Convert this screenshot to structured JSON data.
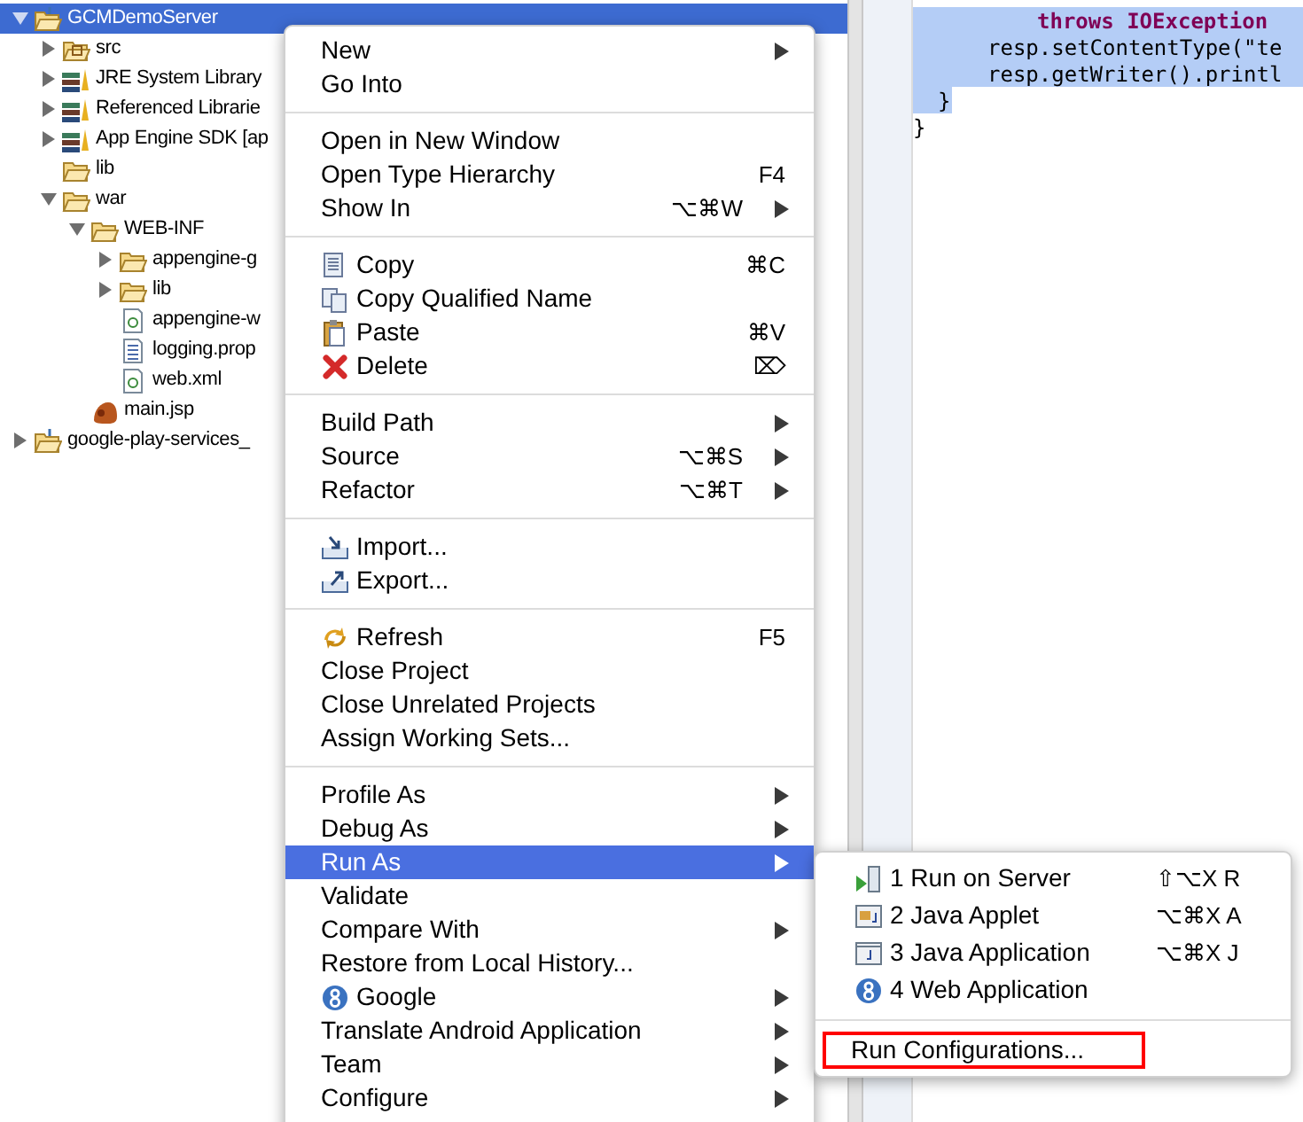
{
  "tree": [
    {
      "label": "GCMDemoServer",
      "kind": "project",
      "expanded": true,
      "selected": true,
      "children": [
        {
          "label": "src",
          "kind": "package-folder",
          "expanded": false,
          "selected": false
        },
        {
          "label": "JRE System Library",
          "kind": "library",
          "expanded": false,
          "selected": false
        },
        {
          "label": "Referenced Librarie",
          "kind": "library",
          "expanded": false,
          "selected": false
        },
        {
          "label": "App Engine SDK [ap",
          "kind": "library",
          "expanded": false,
          "selected": false
        },
        {
          "label": "lib",
          "kind": "folder",
          "selected": false
        },
        {
          "label": "war",
          "kind": "folder",
          "expanded": true,
          "selected": false,
          "children": [
            {
              "label": "WEB-INF",
              "kind": "folder",
              "expanded": true,
              "selected": false,
              "children": [
                {
                  "label": "appengine-g",
                  "kind": "folder",
                  "expanded": false,
                  "selected": false
                },
                {
                  "label": "lib",
                  "kind": "folder",
                  "expanded": false,
                  "selected": false
                },
                {
                  "label": "appengine-w",
                  "kind": "xml",
                  "selected": false
                },
                {
                  "label": "logging.prop",
                  "kind": "text",
                  "selected": false
                },
                {
                  "label": "web.xml",
                  "kind": "xml",
                  "selected": false
                }
              ]
            },
            {
              "label": "main.jsp",
              "kind": "jsp",
              "selected": false
            }
          ]
        }
      ]
    },
    {
      "label": "google-play-services_",
      "kind": "project",
      "expanded": false,
      "selected": false
    }
  ],
  "editor": {
    "lines": [
      {
        "text": "throws IOException",
        "kind": "throws",
        "selected": true
      },
      {
        "text": "resp.setContentType(\"te",
        "kind": "statement",
        "selected": true
      },
      {
        "text": "resp.getWriter().printl",
        "kind": "statement",
        "selected": true
      },
      {
        "text": "}",
        "kind": "method-end",
        "selected": true
      },
      {
        "text": "}",
        "kind": "class-end",
        "selected": false
      }
    ]
  },
  "context_menu": {
    "sections": [
      [
        {
          "label": "New",
          "submenu": true,
          "selected": false
        },
        {
          "label": "Go Into",
          "selected": false
        }
      ],
      [
        {
          "label": "Open in New Window",
          "selected": false
        },
        {
          "label": "Open Type Hierarchy",
          "shortcut": "F4",
          "selected": false
        },
        {
          "label": "Show In",
          "shortcut": "⌥⌘W",
          "submenu": true,
          "selected": false
        }
      ],
      [
        {
          "label": "Copy",
          "kind": "copy",
          "shortcut": "⌘C",
          "selected": false
        },
        {
          "label": "Copy Qualified Name",
          "kind": "copy-qualified",
          "selected": false
        },
        {
          "label": "Paste",
          "kind": "paste",
          "shortcut": "⌘V",
          "selected": false
        },
        {
          "label": "Delete",
          "kind": "delete",
          "shortcut": "⌦",
          "selected": false
        }
      ],
      [
        {
          "label": "Build Path",
          "submenu": true,
          "selected": false
        },
        {
          "label": "Source",
          "shortcut": "⌥⌘S",
          "submenu": true,
          "selected": false
        },
        {
          "label": "Refactor",
          "shortcut": "⌥⌘T",
          "submenu": true,
          "selected": false
        }
      ],
      [
        {
          "label": "Import...",
          "kind": "import",
          "selected": false
        },
        {
          "label": "Export...",
          "kind": "export",
          "selected": false
        }
      ],
      [
        {
          "label": "Refresh",
          "kind": "refresh",
          "shortcut": "F5",
          "selected": false
        },
        {
          "label": "Close Project",
          "selected": false
        },
        {
          "label": "Close Unrelated Projects",
          "selected": false
        },
        {
          "label": "Assign Working Sets...",
          "selected": false
        }
      ],
      [
        {
          "label": "Profile As",
          "submenu": true,
          "selected": false
        },
        {
          "label": "Debug As",
          "submenu": true,
          "selected": false
        },
        {
          "label": "Run As",
          "submenu": true,
          "selected": true
        },
        {
          "label": "Validate",
          "selected": false
        },
        {
          "label": "Compare With",
          "submenu": true,
          "selected": false
        },
        {
          "label": "Restore from Local History...",
          "selected": false
        },
        {
          "label": "Google",
          "kind": "google",
          "submenu": true,
          "selected": false
        },
        {
          "label": "Translate Android Application",
          "submenu": true,
          "selected": false
        },
        {
          "label": "Team",
          "submenu": true,
          "selected": false
        },
        {
          "label": "Configure",
          "submenu": true,
          "selected": false
        }
      ]
    ]
  },
  "submenu": {
    "sections": [
      [
        {
          "label": "1 Run on Server",
          "kind": "server",
          "shortcut": "⇧⌥X R",
          "outlined": false
        },
        {
          "label": "2 Java Applet",
          "kind": "applet",
          "shortcut": "⌥⌘X A",
          "outlined": false
        },
        {
          "label": "3 Java Application",
          "kind": "application",
          "shortcut": "⌥⌘X J",
          "outlined": false
        },
        {
          "label": "4 Web Application",
          "kind": "google",
          "outlined": false
        }
      ],
      [
        {
          "label": "Run Configurations...",
          "outlined": true
        }
      ]
    ]
  }
}
